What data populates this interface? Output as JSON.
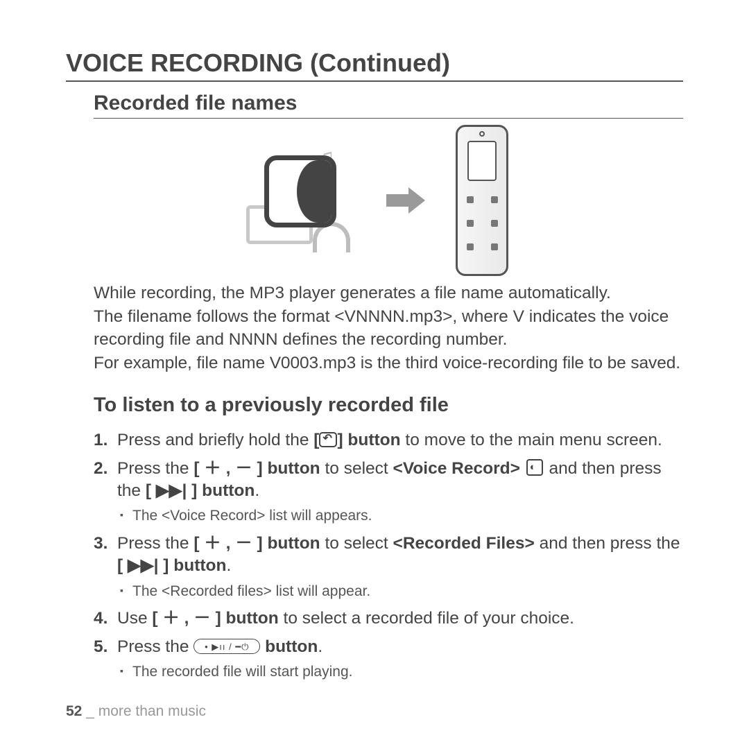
{
  "heading": "VOICE RECORDING (Continued)",
  "sub1": "Recorded file names",
  "intro": {
    "p1": "While recording, the MP3 player generates a file name automatically.",
    "p2": "The filename follows the format <VNNNN.mp3>, where V indicates the voice recording file and NNNN defines the recording number.",
    "p3": "For example, file name V0003.mp3 is the third voice-recording file to be saved."
  },
  "sub2": "To listen to a previously recorded file",
  "steps": {
    "s1a": "Press and briefly hold the ",
    "s1b": "[",
    "s1c": "] button",
    "s1d": " to move to the main menu screen.",
    "s2a": "Press the ",
    "s2b": "[ ＋ , － ] button",
    "s2c": " to select ",
    "s2d": "<Voice Record>",
    "s2e": " and then press the ",
    "s2f": "[ ▶▶| ] button",
    "s2g": ".",
    "s2sub": "The <Voice Record> list will appears.",
    "s3a": "Press the ",
    "s3b": "[ ＋ , － ] button",
    "s3c": " to select ",
    "s3d": "<Recorded Files>",
    "s3e": " and then press the ",
    "s3f": "[ ▶▶| ] button",
    "s3g": ".",
    "s3sub": "The <Recorded files> list will appear.",
    "s4a": "Use ",
    "s4b": "[ ＋ , － ] button",
    "s4c": " to select a recorded file of your choice.",
    "s5a": "Press the ",
    "s5b": " button",
    "s5c": ".",
    "s5sub": "The recorded file will start playing."
  },
  "footer": {
    "page": "52",
    "sep": " _ ",
    "section": "more than music"
  }
}
